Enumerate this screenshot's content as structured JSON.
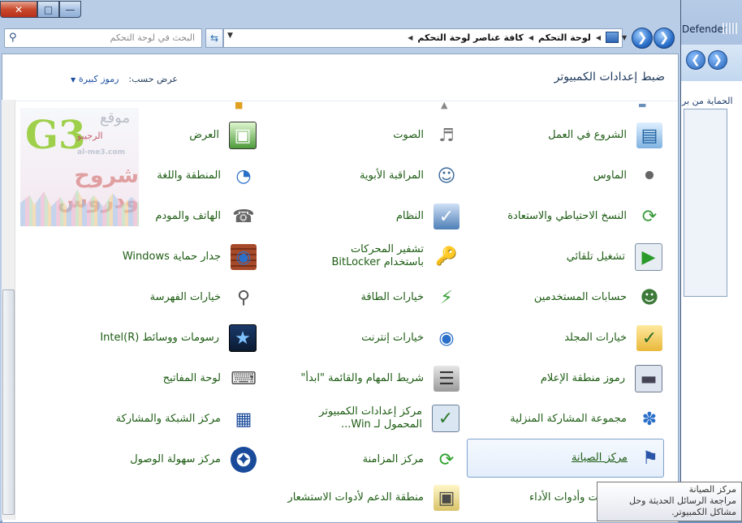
{
  "background_window": {
    "title": "Defender",
    "text": "الحماية من بر"
  },
  "window": {
    "search": {
      "placeholder": "البحث في لوحة التحكم"
    },
    "breadcrumb": [
      "لوحة التحكم",
      "كافة عناصر لوحة التحكم"
    ]
  },
  "header": {
    "title": "ضبط إعدادات الكمبيوتر",
    "view_by_label": "عرض حسب:",
    "view_by_value": "رموز كبيرة"
  },
  "logo": {
    "text_top": "موقع",
    "text_sub": "الرجيبو",
    "url": "al-me3.com",
    "slogan": "شروح ودروس"
  },
  "items": [
    {
      "label": "الشروع في العمل",
      "icon": "getting-started-icon"
    },
    {
      "label": "الماوس",
      "icon": "mouse-icon"
    },
    {
      "label": "النسخ الاحتياطي والاستعادة",
      "icon": "backup-restore-icon"
    },
    {
      "label": "تشغيل تلقائي",
      "icon": "autoplay-icon"
    },
    {
      "label": "حسابات المستخدمين",
      "icon": "user-accounts-icon"
    },
    {
      "label": "خيارات المجلد",
      "icon": "folder-options-icon"
    },
    {
      "label": "رموز منطقة الإعلام",
      "icon": "notification-area-icon"
    },
    {
      "label": "مجموعة المشاركة المنزلية",
      "icon": "homegroup-icon"
    },
    {
      "label": "مركز الصيانة",
      "icon": "action-center-flag-icon"
    },
    {
      "label": "معلومات وأدوات الأداء",
      "icon": "performance-icon"
    },
    {
      "label": "الصوت",
      "icon": "sound-icon"
    },
    {
      "label": "المراقبة الأبوية",
      "icon": "parental-controls-icon"
    },
    {
      "label": "النظام",
      "icon": "system-icon"
    },
    {
      "label": "تشفير المحركات باستخدام BitLocker",
      "icon": "bitlocker-icon"
    },
    {
      "label": "خيارات الطاقة",
      "icon": "power-options-icon"
    },
    {
      "label": "خيارات إنترنت",
      "icon": "internet-options-icon"
    },
    {
      "label": "شريط المهام والقائمة \"ابدأ\"",
      "icon": "taskbar-icon"
    },
    {
      "label": "مركز إعدادات الكمبيوتر المحمول لـ Win...",
      "icon": "mobility-center-icon"
    },
    {
      "label": "مركز المزامنة",
      "icon": "sync-center-icon"
    },
    {
      "label": "منطقة الدعم لأدوات الاستشعار",
      "icon": "sensors-icon"
    },
    {
      "label": "العرض",
      "icon": "display-icon"
    },
    {
      "label": "المنطقة واللغة",
      "icon": "region-language-icon"
    },
    {
      "label": "الهاتف والمودم",
      "icon": "phone-modem-icon"
    },
    {
      "label": "جدار حماية Windows",
      "icon": "firewall-icon"
    },
    {
      "label": "خيارات الفهرسة",
      "icon": "indexing-icon"
    },
    {
      "label": "رسومات ووسائط Intel(R)",
      "icon": "intel-graphics-icon"
    },
    {
      "label": "لوحة المفاتيح",
      "icon": "keyboard-icon"
    },
    {
      "label": "مركز الشبكة والمشاركة",
      "icon": "network-icon"
    },
    {
      "label": "مركز سهولة الوصول",
      "icon": "ease-of-access-icon"
    }
  ],
  "tooltip": {
    "title": "مركز الصيانة",
    "body": "مراجعة الرسائل الحديثة وحل مشاكل الكمبيوتر."
  }
}
